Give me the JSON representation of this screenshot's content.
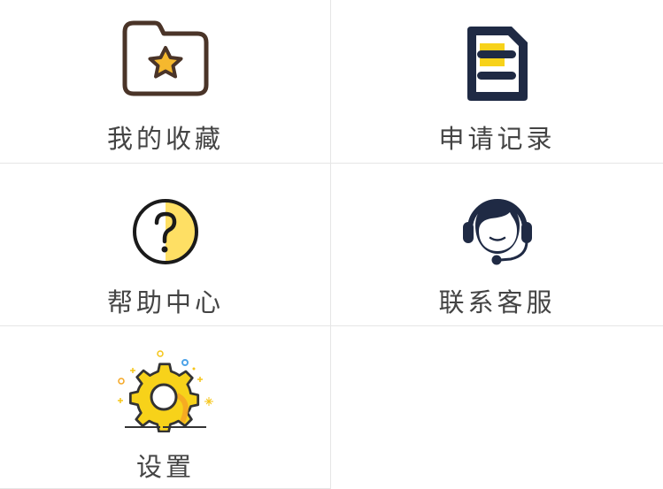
{
  "menu": {
    "items": [
      {
        "label": "我的收藏",
        "icon": "favorites-folder-star-icon"
      },
      {
        "label": "申请记录",
        "icon": "document-record-icon"
      },
      {
        "label": "帮助中心",
        "icon": "help-question-icon"
      },
      {
        "label": "联系客服",
        "icon": "customer-service-headset-icon"
      },
      {
        "label": "设置",
        "icon": "settings-gear-icon"
      }
    ]
  },
  "colors": {
    "divider": "#e6e6e6",
    "text": "#444444",
    "icon_dark": "#1f2a44",
    "icon_brown": "#4a3428",
    "accent_yellow": "#f7d21a",
    "accent_orange": "#f5a623"
  }
}
